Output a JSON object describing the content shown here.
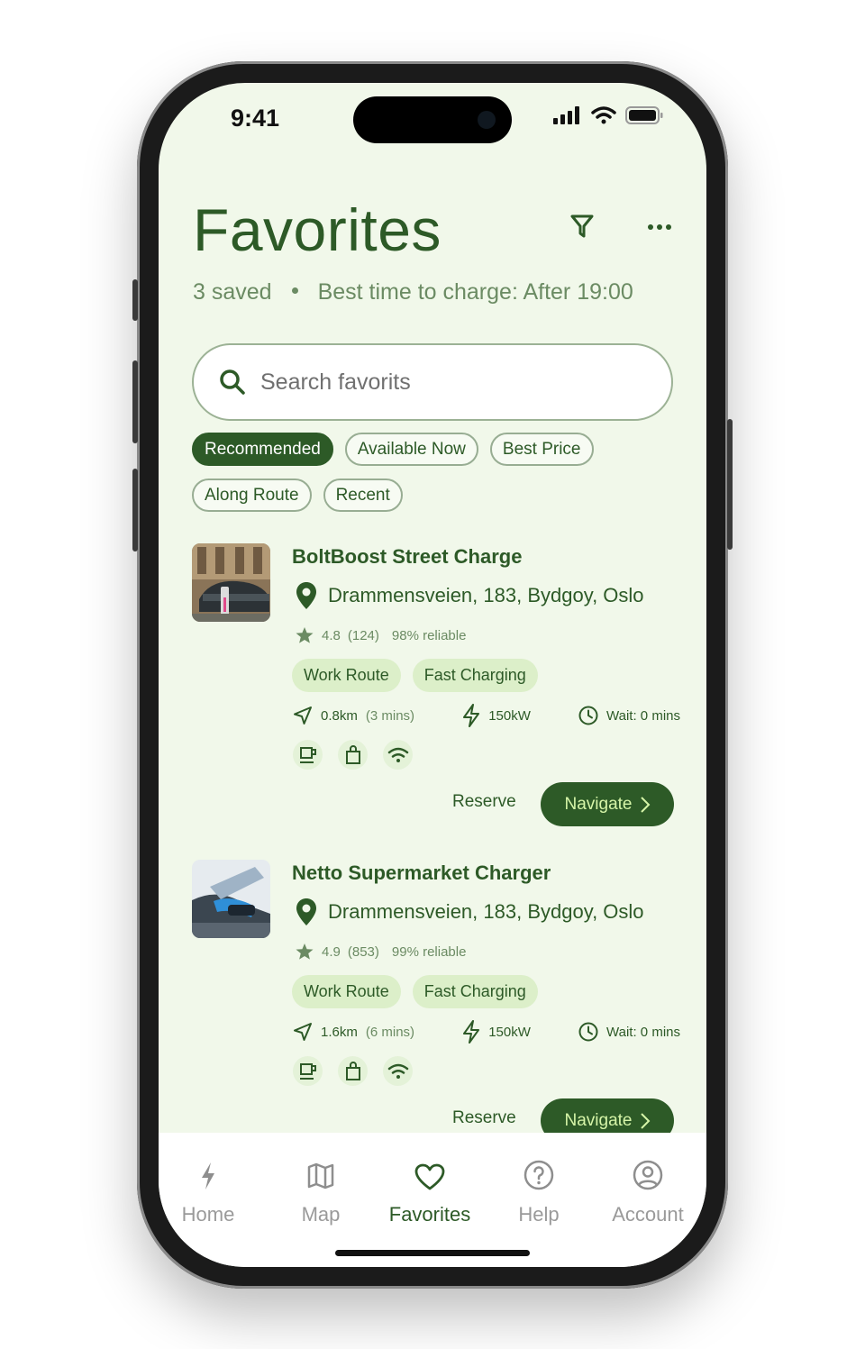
{
  "status": {
    "time": "9:41"
  },
  "header": {
    "title": "Favorites",
    "saved_count": "3 saved",
    "best_time": "Best time to charge: After 19:00"
  },
  "search": {
    "placeholder": "Search favorits"
  },
  "filters": [
    "Recommended",
    "Available Now",
    "Best Price",
    "Along Route",
    "Recent"
  ],
  "active_filter": "Recommended",
  "stations": [
    {
      "name": "BoltBoost Street Charge",
      "address": "Drammensveien, 183, Bydgoy, Oslo",
      "rating": "4.8",
      "reviews": "(124)",
      "reliability": "98% reliable",
      "tags": [
        "Work Route",
        "Fast Charging"
      ],
      "distance": "0.8km",
      "time": "(3 mins)",
      "power": "150kW",
      "wait": "Wait: 0 mins",
      "amenities": [
        "coffee-icon",
        "shopping-bag-icon",
        "wifi-icon"
      ],
      "reserve_label": "Reserve",
      "navigate_label": "Navigate"
    },
    {
      "name": "Netto Supermarket Charger",
      "address": "Drammensveien, 183, Bydgoy, Oslo",
      "rating": "4.9",
      "reviews": "(853)",
      "reliability": "99% reliable",
      "tags": [
        "Work Route",
        "Fast Charging"
      ],
      "distance": "1.6km",
      "time": "(6 mins)",
      "power": "150kW",
      "wait": "Wait: 0 mins",
      "amenities": [
        "coffee-icon",
        "shopping-bag-icon",
        "wifi-icon"
      ],
      "reserve_label": "Reserve",
      "navigate_label": "Navigate"
    }
  ],
  "tabs": [
    {
      "label": "Home",
      "icon": "bolt-icon"
    },
    {
      "label": "Map",
      "icon": "map-icon"
    },
    {
      "label": "Favorites",
      "icon": "heart-icon"
    },
    {
      "label": "Help",
      "icon": "help-icon"
    },
    {
      "label": "Account",
      "icon": "account-icon"
    }
  ],
  "active_tab": "Favorites",
  "colors": {
    "accent": "#2d5a27",
    "background": "#f1f8ea",
    "tag_bg": "#dcefc9",
    "navigate_text": "#d6f5a8"
  }
}
